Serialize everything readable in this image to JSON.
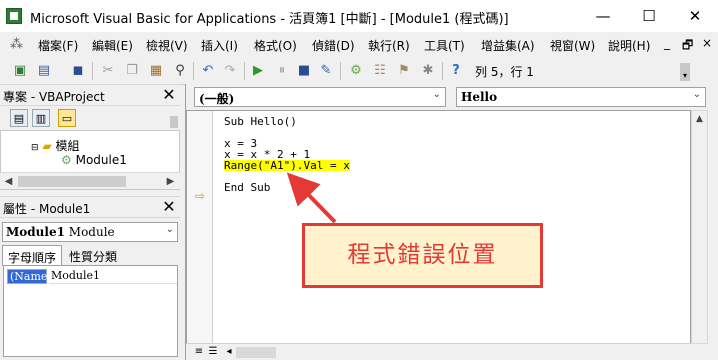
{
  "window": {
    "title": "Microsoft Visual Basic for Applications - 活頁簿1 [中斷] - [Module1 (程式碼)]",
    "minimize": "—",
    "maximize": "☐",
    "close": "✕"
  },
  "menu": {
    "items": [
      "檔案(F)",
      "編輯(E)",
      "檢視(V)",
      "插入(I)",
      "格式(O)",
      "偵錯(D)",
      "執行(R)",
      "工具(T)",
      "增益集(A)",
      "視窗(W)",
      "說明(H)"
    ],
    "doc_controls": [
      "_",
      "🗗",
      "×"
    ]
  },
  "toolbar": {
    "status": "列 5，行 1"
  },
  "project_panel": {
    "title": "專案 - VBAProject",
    "close": "✕",
    "tree": {
      "folder_label": "模組",
      "module_label": "Module1"
    }
  },
  "properties_panel": {
    "title": "屬性 - Module1",
    "close": "✕",
    "object_name": "Module1",
    "object_type": "Module",
    "tabs": [
      "字母順序",
      "性質分類"
    ],
    "rows": [
      {
        "name": "(Name)",
        "value": "Module1"
      }
    ]
  },
  "code_window": {
    "object_combo": "(一般)",
    "proc_combo": "Hello",
    "lines": [
      "Sub Hello()",
      "",
      "x = 3",
      "x = x * 2 + 1",
      "Range(\"A1\").Val = x",
      "",
      "End Sub"
    ],
    "highlight_line": 4
  },
  "annotation": {
    "text": "程式錯誤位置"
  },
  "colors": {
    "highlight": "#ffff00",
    "annotation_border": "#e53935",
    "annotation_fill": "#fff2cc",
    "selection": "#3367d6"
  }
}
